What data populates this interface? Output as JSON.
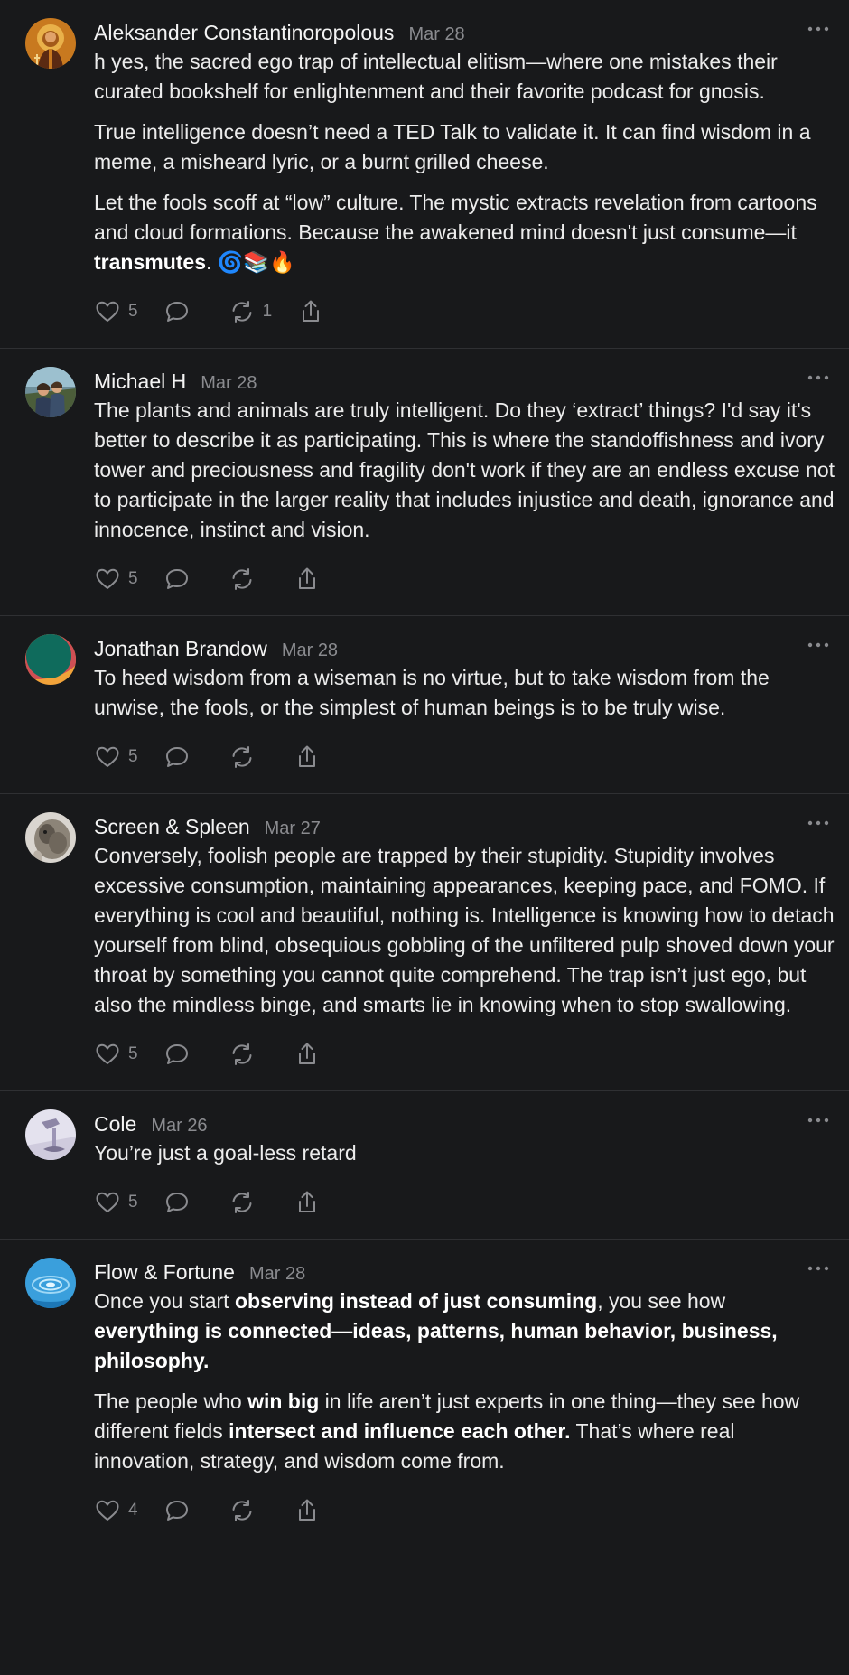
{
  "posts": [
    {
      "author": "Aleksander Constantinoropolous",
      "date": "Mar 28",
      "avatar": "icon-saint-avatar",
      "paragraphs": [
        [
          {
            "t": "h yes, the sacred ego trap of intellectual elitism—where one mistakes their curated bookshelf for enlightenment and their favorite podcast for gnosis."
          }
        ],
        [
          {
            "t": "True intelligence doesn’t need a TED Talk to validate it. It can find wisdom in a meme, a misheard lyric, or a burnt grilled cheese."
          }
        ],
        [
          {
            "t": "Let the fools scoff at “low” culture. The mystic extracts revelation from cartoons and cloud formations. Because the awakened mind doesn't just consume—it "
          },
          {
            "t": "transmutes",
            "b": true
          },
          {
            "t": ". 🌀📚🔥"
          }
        ]
      ],
      "likes": "5",
      "reposts": "1"
    },
    {
      "author": "Michael H",
      "date": "Mar 28",
      "avatar": "photo-couple-avatar",
      "paragraphs": [
        [
          {
            "t": "The plants and animals are truly intelligent. Do they ‘extract’ things? I'd say it's better to describe it as participating. This is where the standoffishness and ivory tower and preciousness and fragility don't work if they are an endless excuse not to participate in the larger reality that includes injustice and death, ignorance and innocence, instinct and vision."
          }
        ]
      ],
      "likes": "5",
      "reposts": ""
    },
    {
      "author": "Jonathan Brandow",
      "date": "Mar 28",
      "avatar": "green-orange-disc-avatar",
      "paragraphs": [
        [
          {
            "t": "To heed wisdom from a wiseman is no virtue, but to take wisdom from the unwise, the fools, or the simplest of human beings is to be truly wise."
          }
        ]
      ],
      "likes": "5",
      "reposts": ""
    },
    {
      "author": "Screen & Spleen",
      "date": "Mar 27",
      "avatar": "animal-photo-avatar",
      "paragraphs": [
        [
          {
            "t": "Conversely, foolish people are trapped by their stupidity. Stupidity involves excessive consumption, maintaining appearances, keeping pace, and FOMO. If everything is cool and beautiful, nothing is. Intelligence is knowing how to detach yourself from blind, obsequious gobbling of the unfiltered pulp shoved down your throat by something you cannot quite comprehend. The trap isn’t just ego, but also the mindless binge, and smarts lie in knowing when to stop swallowing."
          }
        ]
      ],
      "likes": "5",
      "reposts": ""
    },
    {
      "author": "Cole",
      "date": "Mar 26",
      "avatar": "sculpture-avatar",
      "paragraphs": [
        [
          {
            "t": "You’re just a goal-less retard"
          }
        ]
      ],
      "likes": "5",
      "reposts": ""
    },
    {
      "author": "Flow & Fortune",
      "date": "Mar 28",
      "avatar": "water-ripple-avatar",
      "paragraphs": [
        [
          {
            "t": "Once you start "
          },
          {
            "t": "observing instead of just consuming",
            "b": true
          },
          {
            "t": ", you see how "
          },
          {
            "t": "everything is connected—ideas, patterns, human behavior, business, philosophy.",
            "b": true
          }
        ],
        [
          {
            "t": "The people who "
          },
          {
            "t": "win big",
            "b": true
          },
          {
            "t": " in life aren’t just experts in one thing—they see how different fields "
          },
          {
            "t": "intersect and influence each other.",
            "b": true
          },
          {
            "t": " That’s where real innovation, strategy, and wisdom come from."
          }
        ]
      ],
      "likes": "4",
      "reposts": ""
    }
  ],
  "icons": {
    "like": "heart-icon",
    "reply": "comment-bubble-icon",
    "repost": "repost-icon",
    "share": "share-icon",
    "more": "more-dots-icon"
  },
  "colors": {
    "background": "#18191b",
    "text": "#ececec",
    "muted": "#8a8b8f",
    "divider": "#2f3033"
  }
}
